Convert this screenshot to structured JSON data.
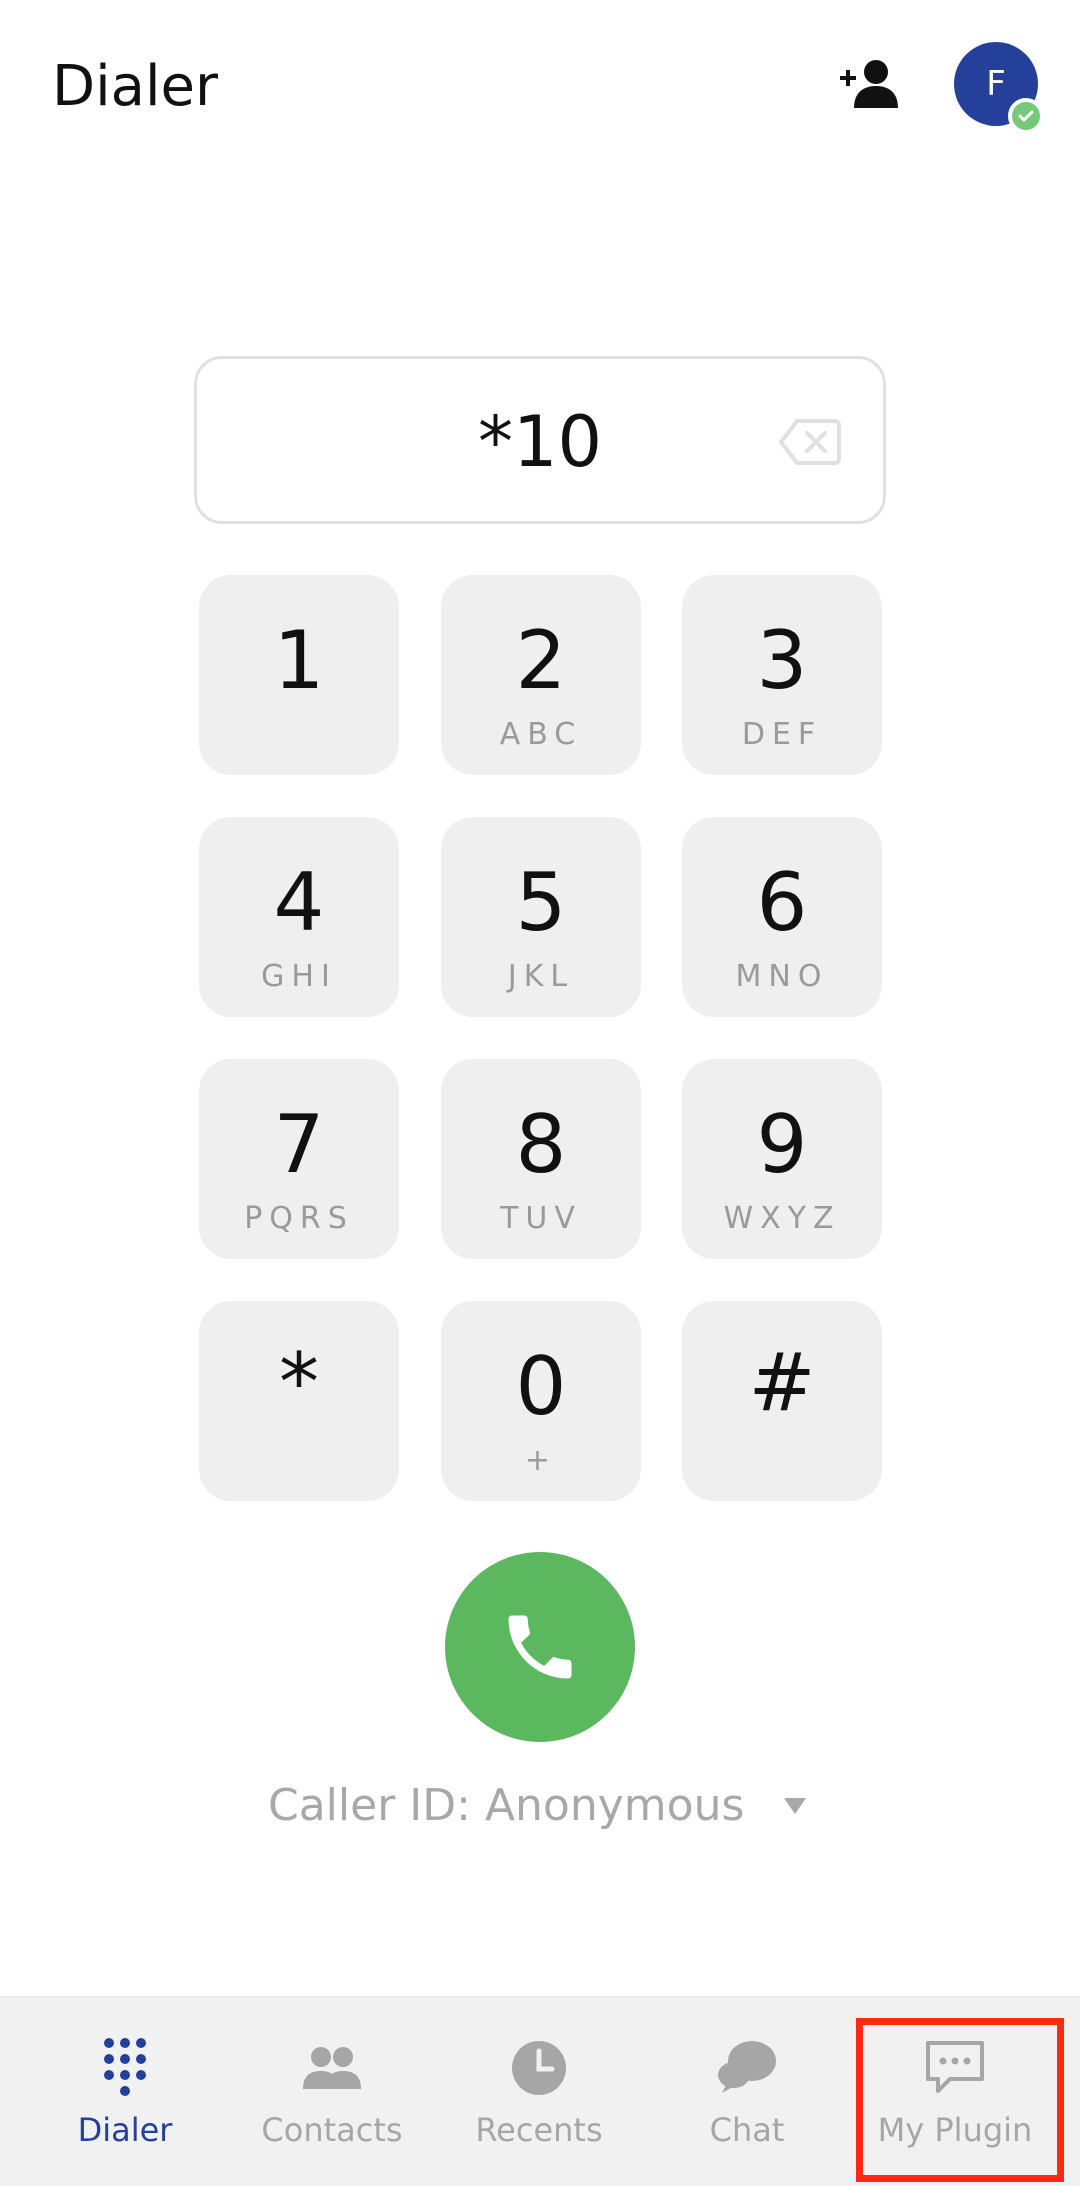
{
  "header": {
    "title": "Dialer",
    "avatar_initial": "F"
  },
  "dialer": {
    "number": "*10",
    "keys": [
      {
        "digit": "1",
        "letters": ""
      },
      {
        "digit": "2",
        "letters": "ABC"
      },
      {
        "digit": "3",
        "letters": "DEF"
      },
      {
        "digit": "4",
        "letters": "GHI"
      },
      {
        "digit": "5",
        "letters": "JKL"
      },
      {
        "digit": "6",
        "letters": "MNO"
      },
      {
        "digit": "7",
        "letters": "PQRS"
      },
      {
        "digit": "8",
        "letters": "TUV"
      },
      {
        "digit": "9",
        "letters": "WXYZ"
      },
      {
        "digit": "*",
        "letters": ""
      },
      {
        "digit": "0",
        "letters": "+"
      },
      {
        "digit": "#",
        "letters": ""
      }
    ],
    "caller_id": "Caller ID: Anonymous"
  },
  "tabs": [
    {
      "label": "Dialer",
      "icon": "keypad-icon",
      "active": true
    },
    {
      "label": "Contacts",
      "icon": "contacts-icon",
      "active": false
    },
    {
      "label": "Recents",
      "icon": "clock-icon",
      "active": false
    },
    {
      "label": "Chat",
      "icon": "chat-icon",
      "active": false
    },
    {
      "label": "My Plugin",
      "icon": "plugin-chat-icon",
      "active": false
    }
  ],
  "colors": {
    "brand": "#24409a",
    "call_green": "#5cb85f",
    "status_green": "#77c97a",
    "highlight": "#ff2a14"
  }
}
